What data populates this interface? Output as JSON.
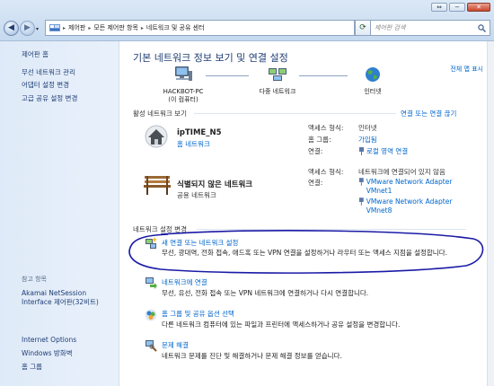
{
  "window": {
    "btn_restore": "⇔",
    "btn_minimize": "−",
    "btn_close": "✕"
  },
  "address": {
    "crumbs": [
      "제어판",
      "모든 제어판 항목",
      "네트워크 및 공유 센터"
    ],
    "search_placeholder": "제어판 검색"
  },
  "sidebar": {
    "home": "제어판 홈",
    "items": [
      "무선 네트워크 관리",
      "어댑터 설정 변경",
      "고급 공유 설정 변경"
    ],
    "see_also_header": "참고 항목",
    "see_also": [
      "Akamai NetSession Interface 제어판(32비트)",
      "Internet Options",
      "Windows 방화벽",
      "홈 그룹"
    ]
  },
  "main": {
    "title": "기본 네트워크 정보 보기 및 연결 설정",
    "full_map": "전체 맵 표시",
    "map": {
      "pc_label": "HACKBOT-PC",
      "pc_sublabel": "(이 컴퓨터)",
      "network_label": "다중 네트워크",
      "internet_label": "인터넷"
    },
    "active_header": "활성 네트워크 보기",
    "connect_toggle": "연결 또는 연결 끊기",
    "networks": [
      {
        "name": "ipTIME_N5",
        "type": "홈 네트워크",
        "access_label": "액세스 형식:",
        "access_value": "인터넷",
        "homegroup_label": "홈 그룹:",
        "homegroup_value": "가입됨",
        "conn_label": "연결:",
        "conn_value": "로컬 영역 연결"
      },
      {
        "name": "식별되지 않은 네트워크",
        "type": "공용 네트워크",
        "access_label": "액세스 형식:",
        "access_value": "네트워크에 연결되어 있지 않음",
        "conn_label": "연결:",
        "conn_values": [
          "VMware Network Adapter VMnet1",
          "VMware Network Adapter VMnet8"
        ]
      }
    ],
    "settings_header": "네트워크 설정 변경",
    "tasks": [
      {
        "title": "새 연결 또는 네트워크 설정",
        "desc": "무선, 광대역, 전화 접속, 애드혹 또는 VPN 연결을 설정하거나 라우터 또는 액세스 지점을 설정합니다."
      },
      {
        "title": "네트워크에 연결",
        "desc": "무선, 유선, 전화 접속 또는 VPN 네트워크에 연결하거나 다시 연결합니다."
      },
      {
        "title": "홈 그룹 및 공유 옵션 선택",
        "desc": "다른 네트워크 컴퓨터에 있는 파일과 프린터에 액세스하거나 공유 설정을 변경합니다."
      },
      {
        "title": "문제 해결",
        "desc": "네트워크 문제를 진단 및 해결하거나 문제 해결 정보를 얻습니다."
      }
    ]
  },
  "colors": {
    "link": "#0066cc",
    "title": "#1e3d73",
    "annotation": "#1a1aa6"
  },
  "icons": [
    "back-arrow-icon",
    "forward-arrow-icon",
    "control-panel-icon",
    "refresh-icon",
    "search-icon",
    "computer-icon",
    "network-icon",
    "globe-icon",
    "house-icon",
    "bench-icon",
    "network-adapter-icon",
    "wizard-icon",
    "connect-icon",
    "homegroup-icon",
    "troubleshoot-icon"
  ]
}
